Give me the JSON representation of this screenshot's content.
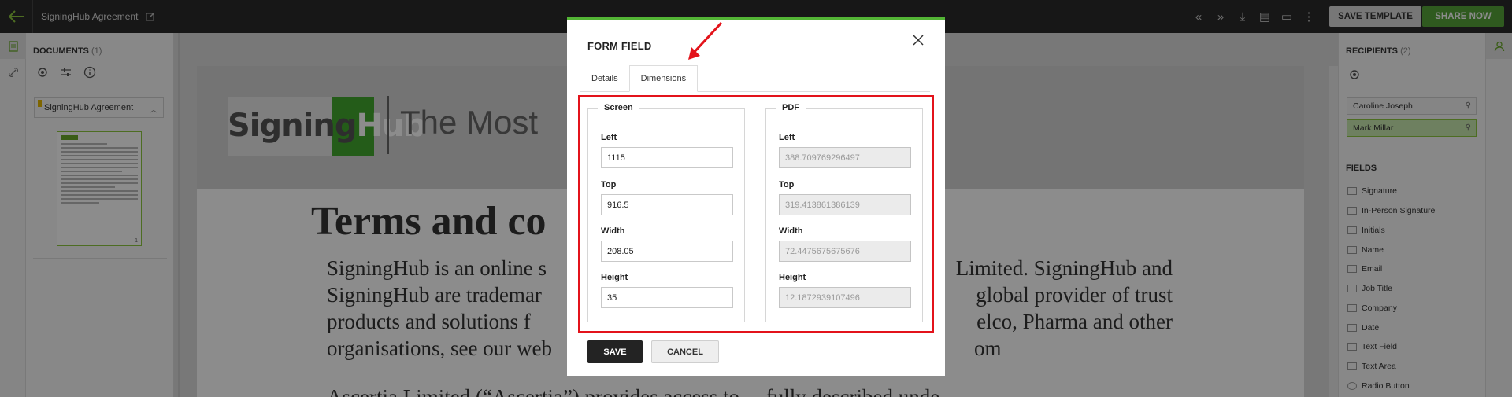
{
  "header": {
    "doc_title": "SigningHub Agreement",
    "save_template": "SAVE TEMPLATE",
    "share_now": "SHARE NOW"
  },
  "documents": {
    "heading": "DOCUMENTS",
    "count": "(1)",
    "item_label": "SigningHub Agreement",
    "page_number": "1"
  },
  "document": {
    "logo_sign": "Signing",
    "logo_hub": "Hub",
    "tagline": "The Most",
    "title": "Terms and co",
    "body_lines": [
      "SigningHub is an online s",
      "SigningHub are trademar",
      "products and solutions f",
      "organisations, see our web"
    ],
    "body_right_lines": [
      "Limited. SigningHub and",
      "global provider of trust",
      "elco, Pharma and other",
      "om"
    ],
    "body2": "Ascertia Limited (“Ascertia”) provides access to ... fully described unde"
  },
  "recipients": {
    "heading": "RECIPIENTS",
    "count": "(2)",
    "items": [
      "Caroline Joseph",
      "Mark Millar"
    ],
    "fields_heading": "FIELDS",
    "fields": [
      "Signature",
      "In-Person Signature",
      "Initials",
      "Name",
      "Email",
      "Job Title",
      "Company",
      "Date",
      "Text Field",
      "Text Area",
      "Radio Button"
    ]
  },
  "modal": {
    "title": "FORM FIELD",
    "tabs": [
      "Details",
      "Dimensions"
    ],
    "active_tab": "Dimensions",
    "screen": {
      "legend": "Screen",
      "left_label": "Left",
      "left_value": "1115",
      "top_label": "Top",
      "top_value": "916.5",
      "width_label": "Width",
      "width_value": "208.05",
      "height_label": "Height",
      "height_value": "35"
    },
    "pdf": {
      "legend": "PDF",
      "left_label": "Left",
      "left_value": "388.709769296497",
      "top_label": "Top",
      "top_value": "319.413861386139",
      "width_label": "Width",
      "width_value": "72.4475675675676",
      "height_label": "Height",
      "height_value": "12.1872939107496"
    },
    "save": "SAVE",
    "cancel": "CANCEL"
  },
  "colors": {
    "accent_green": "#53b435",
    "highlight_red": "#e3131b",
    "topbar": "#2a2a2a"
  }
}
